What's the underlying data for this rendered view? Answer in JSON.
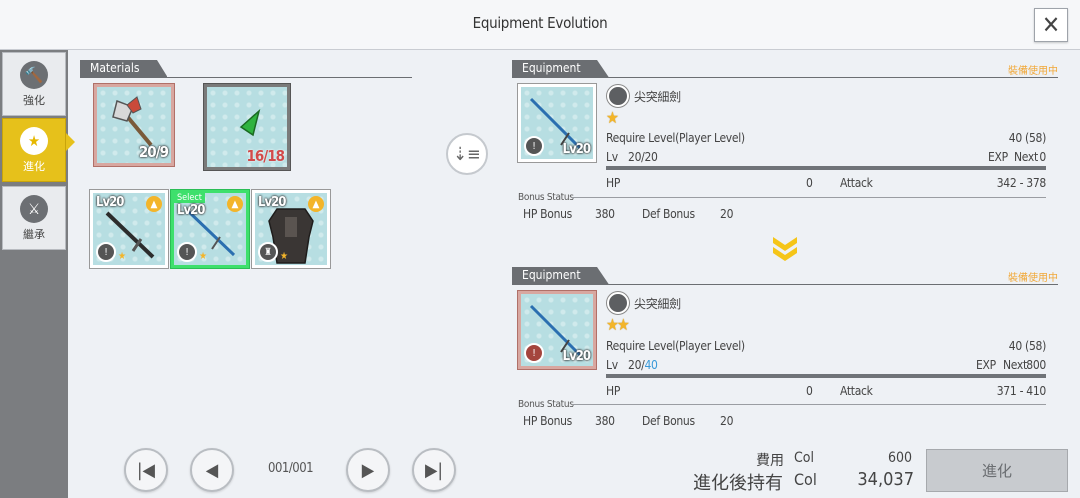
{
  "header": {
    "title": "Equipment Evolution",
    "close_icon": "close-icon"
  },
  "sidebar": {
    "tabs": [
      {
        "label": "強化",
        "icon": "hammer-icon",
        "active": false
      },
      {
        "label": "進化",
        "icon": "star-icon",
        "active": true
      },
      {
        "label": "繼承",
        "icon": "sword-pair-icon",
        "active": false
      }
    ]
  },
  "materials": {
    "title": "Materials",
    "slots": [
      {
        "icon": "axe-icon",
        "count": "20/9",
        "enough": true
      },
      {
        "icon": "green-crystal-icon",
        "count": "16/18",
        "enough": false
      }
    ],
    "items": [
      {
        "level": "Lv20",
        "icon": "long-sword-icon",
        "selected": false
      },
      {
        "level": "Lv20",
        "icon": "rapier-icon",
        "selected": true,
        "select_label": "Select"
      },
      {
        "level": "Lv20",
        "icon": "armor-icon",
        "selected": false
      }
    ]
  },
  "sort_icon": "sort-icon",
  "pager": {
    "page": "001/001"
  },
  "current": {
    "title": "Equipment",
    "equipped_note": "裝備使用中",
    "name": "尖突細劍",
    "card_level": "Lv20",
    "stars": "★",
    "require_label": "Require Level(Player Level)",
    "require_value": "40 (58)",
    "lv_label": "Lv",
    "lv_value": "20/20",
    "lv_max": "",
    "exp_label": "EXP",
    "next_label": "Next",
    "next_value": "0",
    "exp_progress": 1.0,
    "hp_label": "HP",
    "hp_value": "0",
    "attack_label": "Attack",
    "attack_value": "342 - 378",
    "bonus_label": "Bonus Status",
    "hp_bonus_label": "HP Bonus",
    "hp_bonus_value": "380",
    "def_bonus_label": "Def Bonus",
    "def_bonus_value": "20"
  },
  "evolved": {
    "title": "Equipment",
    "equipped_note": "裝備使用中",
    "name": "尖突細劍",
    "card_level": "Lv20",
    "stars": "★★",
    "require_label": "Require Level(Player Level)",
    "require_value": "40 (58)",
    "lv_label": "Lv",
    "lv_value": "20/",
    "lv_max": "40",
    "exp_label": "EXP",
    "next_label": "Next",
    "next_value": "800",
    "exp_progress": 1.0,
    "hp_label": "HP",
    "hp_value": "0",
    "attack_label": "Attack",
    "attack_value": "371 - 410",
    "bonus_label": "Bonus Status",
    "hp_bonus_label": "HP Bonus",
    "hp_bonus_value": "380",
    "def_bonus_label": "Def Bonus",
    "def_bonus_value": "20"
  },
  "cost": {
    "fee_label": "費用",
    "fee_unit": "Col",
    "fee_value": "600",
    "after_label": "進化後持有",
    "after_unit": "Col",
    "after_value": "34,037"
  },
  "evolve_button": "進化",
  "colors": {
    "accent": "#e6c11b",
    "star": "#f3b52a",
    "selected": "#3ee06c",
    "note": "#f1a838"
  }
}
